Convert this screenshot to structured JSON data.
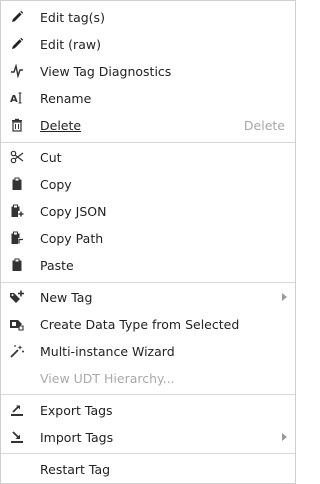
{
  "menu": {
    "edit_tags": "Edit tag(s)",
    "edit_raw": "Edit (raw)",
    "view_diagnostics": "View Tag Diagnostics",
    "rename": "Rename",
    "delete": "Delete",
    "delete_shortcut": "Delete",
    "cut": "Cut",
    "copy": "Copy",
    "copy_json": "Copy JSON",
    "copy_path": "Copy Path",
    "paste": "Paste",
    "new_tag": "New Tag",
    "create_data_type": "Create Data Type from Selected",
    "multi_instance_wizard": "Multi-instance Wizard",
    "view_udt_hierarchy": "View UDT Hierarchy...",
    "export_tags": "Export Tags",
    "import_tags": "Import Tags",
    "restart_tag": "Restart Tag"
  },
  "icons": {
    "edit_tags": "pencil-icon",
    "edit_raw": "pencil-icon",
    "view_diagnostics": "pulse-icon",
    "rename": "rename-icon",
    "delete": "trash-icon",
    "cut": "scissors-icon",
    "copy": "clipboard-icon",
    "copy_json": "clipboard-plus-icon",
    "copy_path": "clipboard-path-icon",
    "paste": "clipboard-icon",
    "new_tag": "tag-plus-icon",
    "create_data_type": "data-type-icon",
    "multi_instance_wizard": "wand-icon",
    "export_tags": "export-icon",
    "import_tags": "import-icon"
  },
  "colors": {
    "text": "#222222",
    "disabled_text": "#a9a9a9",
    "icon": "#333333",
    "separator": "#d6d6d6"
  }
}
